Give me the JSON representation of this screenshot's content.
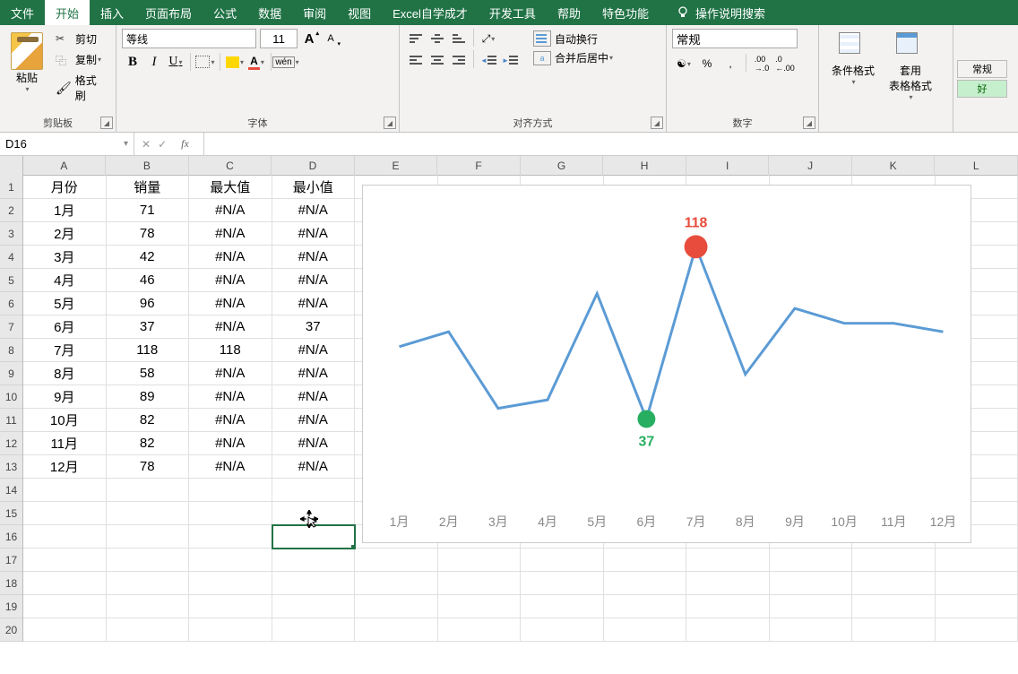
{
  "menu": {
    "file": "文件",
    "home": "开始",
    "insert": "插入",
    "page_layout": "页面布局",
    "formulas": "公式",
    "data": "数据",
    "review": "审阅",
    "view": "视图",
    "excel_self": "Excel自学成才",
    "dev": "开发工具",
    "help": "帮助",
    "special": "特色功能",
    "tell_me": "操作说明搜索"
  },
  "ribbon": {
    "clipboard": {
      "label": "剪贴板",
      "paste": "粘贴",
      "cut": "剪切",
      "copy": "复制",
      "fmt_painter": "格式刷"
    },
    "font": {
      "label": "字体",
      "name": "等线",
      "size": "11",
      "wen": "wén",
      "a_label": "A",
      "b": "B",
      "i": "I",
      "u": "U"
    },
    "align": {
      "label": "对齐方式",
      "wrap": "自动换行",
      "merge": "合并后居中"
    },
    "number": {
      "label": "数字",
      "fmt": "常规",
      "pct": "%",
      "comma": ",",
      "dec_inc": ".00→.0",
      "dec_dec": ".0←.00"
    },
    "styles": {
      "cond_fmt": "条件格式",
      "table_fmt": "套用\n表格格式",
      "general": "常规",
      "good": "好"
    }
  },
  "namebox": "D16",
  "formula": "",
  "cols": [
    "A",
    "B",
    "C",
    "D",
    "E",
    "F",
    "G",
    "H",
    "I",
    "J",
    "K",
    "L"
  ],
  "rows": [
    1,
    2,
    3,
    4,
    5,
    6,
    7,
    8,
    9,
    10,
    11,
    12,
    13,
    14,
    15,
    16,
    17,
    18,
    19,
    20
  ],
  "table": {
    "headers": [
      "月份",
      "销量",
      "最大值",
      "最小值"
    ],
    "data": [
      [
        "1月",
        71,
        "#N/A",
        "#N/A"
      ],
      [
        "2月",
        78,
        "#N/A",
        "#N/A"
      ],
      [
        "3月",
        42,
        "#N/A",
        "#N/A"
      ],
      [
        "4月",
        46,
        "#N/A",
        "#N/A"
      ],
      [
        "5月",
        96,
        "#N/A",
        "#N/A"
      ],
      [
        "6月",
        37,
        "#N/A",
        "37"
      ],
      [
        "7月",
        118,
        "118",
        "#N/A"
      ],
      [
        "8月",
        58,
        "#N/A",
        "#N/A"
      ],
      [
        "9月",
        89,
        "#N/A",
        "#N/A"
      ],
      [
        "10月",
        82,
        "#N/A",
        "#N/A"
      ],
      [
        "11月",
        82,
        "#N/A",
        "#N/A"
      ],
      [
        "12月",
        78,
        "#N/A",
        "#N/A"
      ]
    ]
  },
  "chart_data": {
    "type": "line",
    "categories": [
      "1月",
      "2月",
      "3月",
      "4月",
      "5月",
      "6月",
      "7月",
      "8月",
      "9月",
      "10月",
      "11月",
      "12月"
    ],
    "series": [
      {
        "name": "销量",
        "values": [
          71,
          78,
          42,
          46,
          96,
          37,
          118,
          58,
          89,
          82,
          82,
          78
        ]
      }
    ],
    "max_point": {
      "category": "7月",
      "value": 118,
      "label": "118",
      "color": "#e74c3c"
    },
    "min_point": {
      "category": "6月",
      "value": 37,
      "label": "37",
      "color": "#27ae60"
    },
    "ylim": [
      0,
      130
    ],
    "title": "",
    "xlabel": "",
    "ylabel": ""
  }
}
